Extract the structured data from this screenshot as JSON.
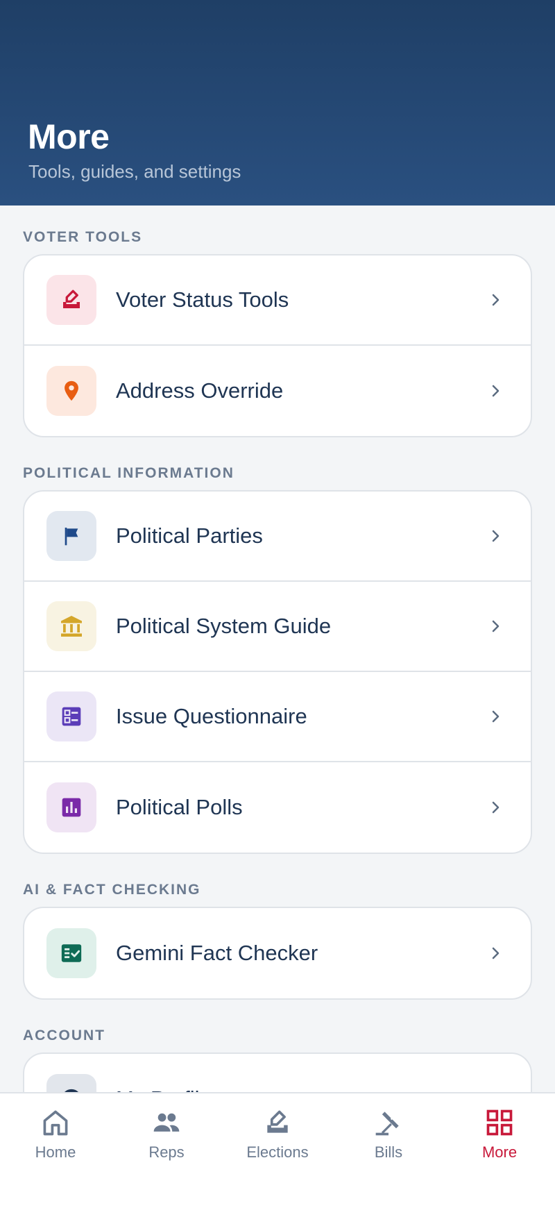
{
  "header": {
    "title": "More",
    "subtitle": "Tools, guides, and settings"
  },
  "sections": [
    {
      "title": "VOTER TOOLS",
      "items": [
        {
          "label": "Voter Status Tools",
          "icon": "ballot-box-icon",
          "color": "#c8193a",
          "bg": "#fbe4e8"
        },
        {
          "label": "Address Override",
          "icon": "map-pin-icon",
          "color": "#e85d12",
          "bg": "#fde8de"
        }
      ]
    },
    {
      "title": "POLITICAL INFORMATION",
      "items": [
        {
          "label": "Political Parties",
          "icon": "flag-icon",
          "color": "#1f4a8a",
          "bg": "#e2e8f0"
        },
        {
          "label": "Political System Guide",
          "icon": "government-building-icon",
          "color": "#d4a62a",
          "bg": "#f8f3e2"
        },
        {
          "label": "Issue Questionnaire",
          "icon": "checklist-icon",
          "color": "#5b3db8",
          "bg": "#ebe6f6"
        },
        {
          "label": "Political Polls",
          "icon": "poll-chart-icon",
          "color": "#7a2aa8",
          "bg": "#f0e4f4"
        }
      ]
    },
    {
      "title": "AI & FACT CHECKING",
      "items": [
        {
          "label": "Gemini Fact Checker",
          "icon": "fact-check-icon",
          "color": "#0e6b55",
          "bg": "#dff0ea"
        }
      ]
    },
    {
      "title": "ACCOUNT",
      "items": [
        {
          "label": "My Profile",
          "icon": "profile-icon",
          "color": "#1f3553",
          "bg": "#e2e6ec"
        }
      ]
    }
  ],
  "tabbar": {
    "tabs": [
      {
        "label": "Home",
        "icon": "home-icon",
        "active": false
      },
      {
        "label": "Reps",
        "icon": "people-icon",
        "active": false
      },
      {
        "label": "Elections",
        "icon": "ballot-box-icon",
        "active": false
      },
      {
        "label": "Bills",
        "icon": "gavel-icon",
        "active": false
      },
      {
        "label": "More",
        "icon": "grid-icon",
        "active": true
      }
    ],
    "active_color": "#c8193a",
    "inactive_color": "#6b7a8f"
  }
}
